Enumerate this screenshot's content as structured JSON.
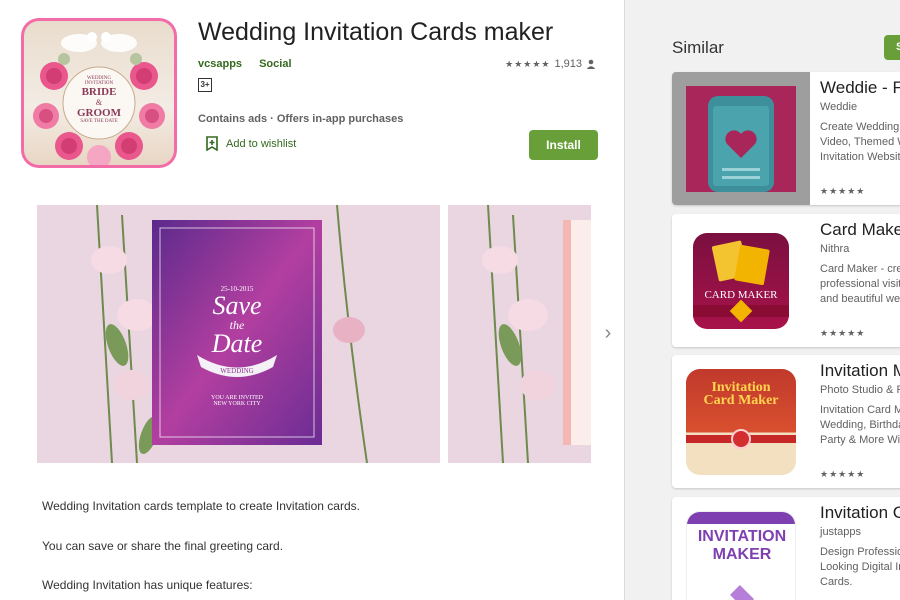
{
  "app": {
    "title": "Wedding Invitation Cards maker",
    "developer": "vcsapps",
    "category": "Social",
    "stars": "★★★★★",
    "rating_count": "1,913",
    "age_rating": "3+",
    "contains": "Contains ads · Offers in-app purchases",
    "wishlist_label": "Add to wishlist",
    "install_label": "Install",
    "icon_text": {
      "line1": "WEDDING",
      "line2": "INVITATION",
      "line3": "BRIDE",
      "amp": "&",
      "line4": "GROOM",
      "line5": "SAVE THE DATE"
    }
  },
  "screenshot": {
    "date": "25-10-2015",
    "save": "Save",
    "the": "the",
    "date_word": "Date",
    "banner": "WEDDING",
    "invited": "YOU ARE INVITED",
    "city": "NEW YORK CITY"
  },
  "description": [
    "Wedding Invitation cards template to create Invitation cards.",
    "You can save or share the final greeting card.",
    "Wedding Invitation has unique features:"
  ],
  "sidebar": {
    "title": "Similar",
    "see_more": "S",
    "cards": [
      {
        "name": "Weddie - Fr",
        "dev": "Weddie",
        "desc": "Create Wedding\nVideo, Themed W\nInvitation Websit",
        "stars": "★★★★★"
      },
      {
        "name": "Card Maker",
        "dev": "Nithra",
        "desc": "Card Maker - cre\nprofessional visit\nand beautiful we",
        "stars": "★★★★★",
        "thumb_label": "CARD MAKER"
      },
      {
        "name": "Invitation M",
        "dev": "Photo Studio & P",
        "desc": "Invitation Card M\nWedding, Birthda\nParty & More Wit",
        "stars": "★★★★★",
        "thumb_label": "Invitation Card Maker"
      },
      {
        "name": "Invitation C",
        "dev": "justapps",
        "desc": "Design Professio\nLooking Digital In\nCards.",
        "stars": "★★★★★",
        "thumb_label": "INVITATION MAKER"
      }
    ]
  },
  "colors": {
    "accent": "#689f38",
    "accent_text": "#33691e",
    "icon_border": "#f26ca7"
  },
  "icons": {
    "wishlist": "bookmark-plus-icon",
    "next": "chevron-right-icon",
    "person": "person-icon"
  }
}
